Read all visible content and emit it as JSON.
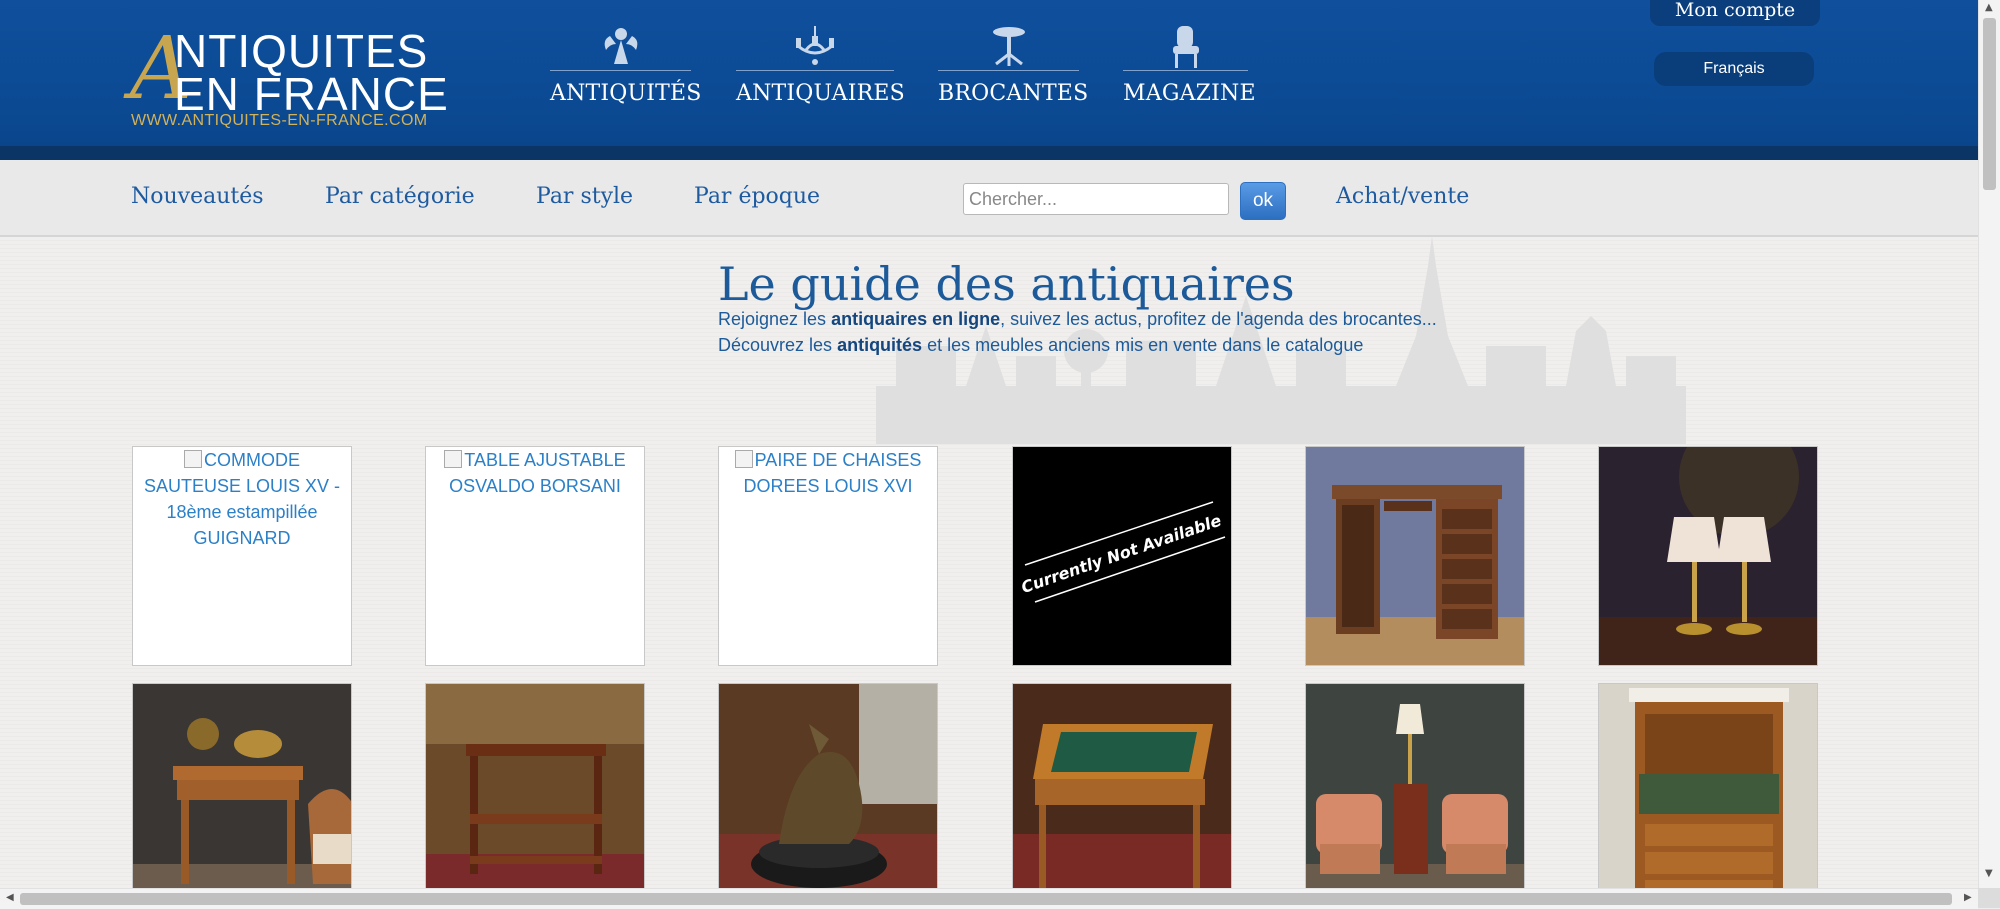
{
  "logo": {
    "letter": "A",
    "line1": "NTIQUITES",
    "line2": "EN FRANCE",
    "url": "WWW.ANTIQUITES-EN-FRANCE.COM"
  },
  "main_nav": [
    {
      "label": "ANTIQUITÉS",
      "icon": "cherub-icon"
    },
    {
      "label": "ANTIQUAIRES",
      "icon": "chandelier-icon"
    },
    {
      "label": "BROCANTES",
      "icon": "pedestal-table-icon"
    },
    {
      "label": "MAGAZINE",
      "icon": "armchair-icon"
    }
  ],
  "account": {
    "label": "Mon compte"
  },
  "language": {
    "label": "Français"
  },
  "sub_nav": [
    "Nouveautés",
    "Par catégorie",
    "Par style",
    "Par époque"
  ],
  "search": {
    "placeholder": "Chercher...",
    "button": "ok"
  },
  "achat_vente": "Achat/vente",
  "hero": {
    "title": "Le guide des antiquaires",
    "line1": {
      "pre": "Rejoignez les ",
      "bold": "antiquaires en ligne",
      "post": ", suivez les actus, profitez de l'agenda des brocantes..."
    },
    "line2": {
      "pre": "Découvrez les ",
      "bold": "antiquités",
      "post": " et les meubles anciens mis en vente dans le catalogue"
    }
  },
  "products": [
    {
      "alt": "COMMODE SAUTEUSE LOUIS XV - 18ème estampillée GUIGNARD",
      "broken": true
    },
    {
      "alt": "TABLE AJUSTABLE OSVALDO BORSANI",
      "broken": true
    },
    {
      "alt": "PAIRE DE CHAISES DOREES LOUIS XVI",
      "broken": true
    },
    {
      "overlay": "Currently Not Available",
      "subject": "unavailable"
    },
    {
      "subject": "writing-desk"
    },
    {
      "subject": "pair-of-lamps"
    },
    {
      "subject": "side-table"
    },
    {
      "subject": "trolley-table"
    },
    {
      "subject": "bronze-sculpture"
    },
    {
      "subject": "game-table"
    },
    {
      "subject": "armchairs-and-side-table"
    },
    {
      "subject": "secretary-desk"
    }
  ]
}
